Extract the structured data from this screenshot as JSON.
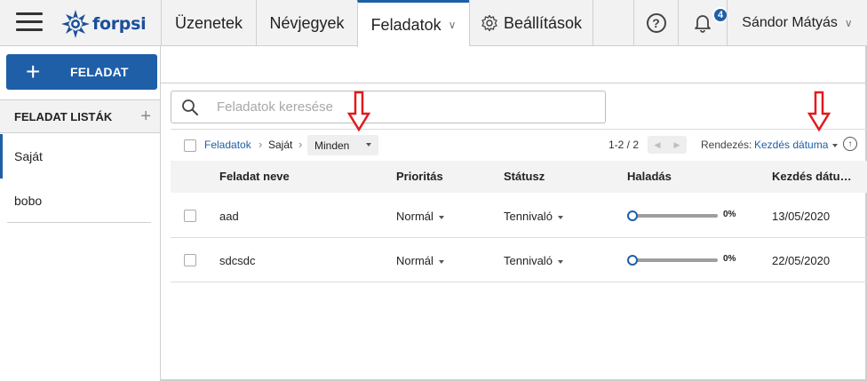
{
  "app": {
    "logo_text": "forpsi",
    "brand_color": "#1e5fa8"
  },
  "topbar": {
    "tabs": [
      {
        "label": "Üzenetek"
      },
      {
        "label": "Névjegyek"
      },
      {
        "label": "Feladatok",
        "active": true,
        "has_dropdown": true
      },
      {
        "label": "Beállítások",
        "icon": "gear-icon"
      }
    ],
    "help_icon": "question-circle-icon",
    "notifications": {
      "icon": "bell-icon",
      "count": "4"
    },
    "user": {
      "name": "Sándor Mátyás"
    }
  },
  "sidebar": {
    "add_button_label": "FELADAT",
    "lists_header": "FELADAT LISTÁK",
    "items": [
      {
        "label": "Saját",
        "active": true
      },
      {
        "label": "bobo"
      }
    ]
  },
  "search": {
    "placeholder": "Feladatok keresése"
  },
  "breadcrumb": {
    "root": "Feladatok",
    "current": "Saját",
    "filter": "Minden"
  },
  "pager": {
    "range": "1-2 / 2"
  },
  "sort": {
    "label": "Rendezés:",
    "value": "Kezdés dátuma"
  },
  "table": {
    "columns": [
      "Feladat neve",
      "Prioritás",
      "Státusz",
      "Haladás",
      "Kezdés dátu…"
    ],
    "rows": [
      {
        "name": "aad",
        "priority": "Normál",
        "status": "Tennivaló",
        "progress": "0%",
        "progress_value": 0,
        "start": "13/05/2020"
      },
      {
        "name": "sdcsdc",
        "priority": "Normál",
        "status": "Tennivaló",
        "progress": "0%",
        "progress_value": 0,
        "start": "22/05/2020"
      }
    ]
  },
  "annotations": {
    "arrow_color": "#e01b1b"
  }
}
